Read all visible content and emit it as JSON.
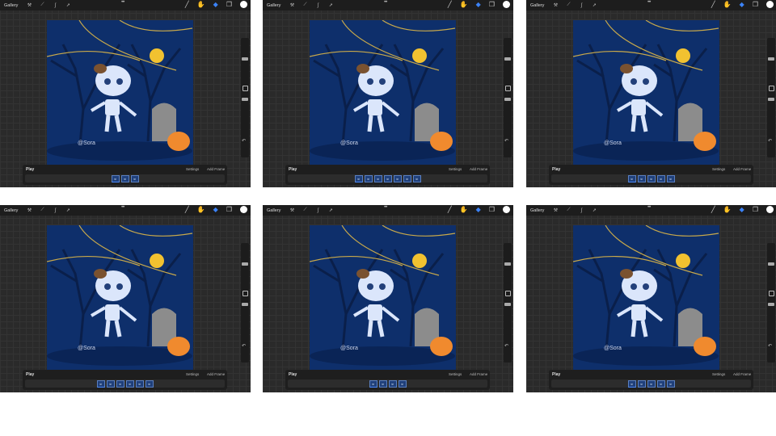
{
  "toolbar": {
    "gallery": "Gallery",
    "more": "•••"
  },
  "timeline": {
    "play": "Play",
    "settings": "Settings",
    "add_frame": "Add Frame"
  },
  "artwork": {
    "signature": "@Sora"
  },
  "colors": {
    "canvas_bg": "#0e2f6b",
    "moon": "#f2c230",
    "pumpkin": "#f08a2e",
    "accent": "#3b82f6"
  },
  "panels": [
    {
      "frame_count": 3
    },
    {
      "frame_count": 7
    },
    {
      "frame_count": 5
    },
    {
      "frame_count": 6
    },
    {
      "frame_count": 4
    },
    {
      "frame_count": 5
    }
  ]
}
